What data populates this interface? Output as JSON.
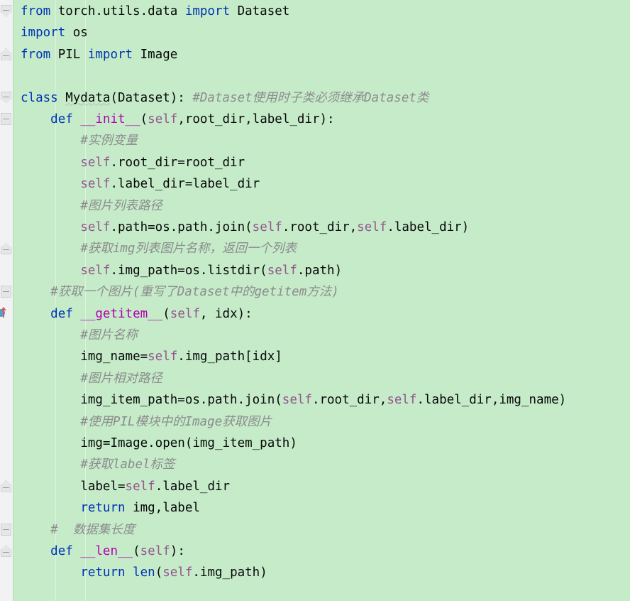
{
  "editor": {
    "app": "code-editor",
    "language": "Python",
    "background_color": "#c5ebc9",
    "gutter_color": "#f2f2f2",
    "colors": {
      "keyword": "#0033b3",
      "self": "#94558d",
      "dunder_method": "#b200b2",
      "comment": "#8c8c8c",
      "text": "#080808",
      "highlight_bg": "#c5ebc9"
    }
  },
  "gutter": {
    "override_marker_tooltip": "Overrides method in Dataset",
    "fold_markers": [
      {
        "type": "start",
        "line": 1
      },
      {
        "type": "end",
        "line": 3
      },
      {
        "type": "start",
        "line": 5
      },
      {
        "type": "stub",
        "line": 6
      },
      {
        "type": "end",
        "line": 12
      },
      {
        "type": "stub",
        "line": 14
      },
      {
        "type": "end",
        "line": 23
      },
      {
        "type": "stub",
        "line": 25
      },
      {
        "type": "end",
        "line": 26
      }
    ]
  },
  "code": {
    "lines": [
      {
        "n": 1,
        "indent": 0,
        "tokens": [
          {
            "t": "kw",
            "v": "from"
          },
          {
            "t": "id",
            "v": " torch.utils.data "
          },
          {
            "t": "kw",
            "v": "import"
          },
          {
            "t": "id",
            "v": " Dataset"
          }
        ]
      },
      {
        "n": 2,
        "indent": 0,
        "tokens": [
          {
            "t": "kw",
            "v": "import"
          },
          {
            "t": "id",
            "v": " os"
          }
        ]
      },
      {
        "n": 3,
        "indent": 0,
        "tokens": [
          {
            "t": "kw",
            "v": "from"
          },
          {
            "t": "id",
            "v": " PIL "
          },
          {
            "t": "kw",
            "v": "import"
          },
          {
            "t": "id",
            "v": " Image"
          }
        ]
      },
      {
        "n": 4,
        "indent": 0,
        "tokens": []
      },
      {
        "n": 5,
        "indent": 0,
        "tokens": [
          {
            "t": "kw",
            "v": "class"
          },
          {
            "t": "id",
            "v": " "
          },
          {
            "t": "wavy",
            "v": "Mydata"
          },
          {
            "t": "id",
            "v": "(Dataset): "
          },
          {
            "t": "cm",
            "v": "#Dataset使用时子类必须继承Dataset类"
          }
        ]
      },
      {
        "n": 6,
        "indent": 1,
        "tokens": [
          {
            "t": "kw",
            "v": "def"
          },
          {
            "t": "id",
            "v": " "
          },
          {
            "t": "fn",
            "v": "__init__"
          },
          {
            "t": "id",
            "v": "("
          },
          {
            "t": "self",
            "v": "self"
          },
          {
            "t": "id",
            "v": ",root_dir,label_dir):"
          }
        ]
      },
      {
        "n": 7,
        "indent": 2,
        "tokens": [
          {
            "t": "cm",
            "v": "#实例变量"
          }
        ]
      },
      {
        "n": 8,
        "indent": 2,
        "tokens": [
          {
            "t": "self",
            "v": "self"
          },
          {
            "t": "id",
            "v": ".root_dir=root_dir"
          }
        ]
      },
      {
        "n": 9,
        "indent": 2,
        "tokens": [
          {
            "t": "self",
            "v": "self"
          },
          {
            "t": "id",
            "v": ".label_dir=label_dir"
          }
        ]
      },
      {
        "n": 10,
        "indent": 2,
        "tokens": [
          {
            "t": "cm",
            "v": "#图片列表路径"
          }
        ]
      },
      {
        "n": 11,
        "indent": 2,
        "tokens": [
          {
            "t": "self",
            "v": "self"
          },
          {
            "t": "id",
            "v": ".path=os.path.join("
          },
          {
            "t": "self",
            "v": "self"
          },
          {
            "t": "id",
            "v": ".root_dir,"
          },
          {
            "t": "self",
            "v": "self"
          },
          {
            "t": "id",
            "v": ".label_dir)"
          }
        ]
      },
      {
        "n": 12,
        "indent": 2,
        "tokens": [
          {
            "t": "cm",
            "v": "#获取img列表图片名称，返回一个列表"
          }
        ]
      },
      {
        "n": 13,
        "indent": 2,
        "tokens": [
          {
            "t": "self",
            "v": "self"
          },
          {
            "t": "id",
            "v": ".img_path=os.listdir("
          },
          {
            "t": "self",
            "v": "self"
          },
          {
            "t": "id",
            "v": ".path)"
          }
        ]
      },
      {
        "n": 14,
        "indent": 1,
        "tokens": [
          {
            "t": "cm",
            "v": "#获取一个图片(重写了Dataset中的getitem方法)"
          }
        ]
      },
      {
        "n": 15,
        "indent": 1,
        "tokens": [
          {
            "t": "kw",
            "v": "def"
          },
          {
            "t": "id",
            "v": " "
          },
          {
            "t": "fn",
            "v": "__getitem__"
          },
          {
            "t": "id",
            "v": "("
          },
          {
            "t": "self",
            "v": "self"
          },
          {
            "t": "id",
            "v": ", idx):"
          }
        ]
      },
      {
        "n": 16,
        "indent": 2,
        "tokens": [
          {
            "t": "cm",
            "v": "#图片名称"
          }
        ]
      },
      {
        "n": 17,
        "indent": 2,
        "tokens": [
          {
            "t": "id",
            "v": "img_name="
          },
          {
            "t": "self",
            "v": "self"
          },
          {
            "t": "id",
            "v": ".img_path[idx]"
          }
        ]
      },
      {
        "n": 18,
        "indent": 2,
        "tokens": [
          {
            "t": "cm",
            "v": "#图片相对路径"
          }
        ]
      },
      {
        "n": 19,
        "indent": 2,
        "tokens": [
          {
            "t": "id",
            "v": "img_item_path=os.path.join("
          },
          {
            "t": "self",
            "v": "self"
          },
          {
            "t": "id",
            "v": ".root_dir,"
          },
          {
            "t": "self",
            "v": "self"
          },
          {
            "t": "id",
            "v": ".label_dir,img_name)"
          }
        ]
      },
      {
        "n": 20,
        "indent": 2,
        "tokens": [
          {
            "t": "cm",
            "v": "#使用PIL模块中的Image获取图片"
          }
        ]
      },
      {
        "n": 21,
        "indent": 2,
        "tokens": [
          {
            "t": "id",
            "v": "img=Image.open(img_item_path)"
          }
        ]
      },
      {
        "n": 22,
        "indent": 2,
        "tokens": [
          {
            "t": "cm",
            "v": "#获取label标签"
          }
        ]
      },
      {
        "n": 23,
        "indent": 2,
        "tokens": [
          {
            "t": "id",
            "v": "label="
          },
          {
            "t": "self",
            "v": "self"
          },
          {
            "t": "id",
            "v": ".label_dir"
          }
        ]
      },
      {
        "n": 24,
        "indent": 2,
        "tokens": [
          {
            "t": "kw",
            "v": "return"
          },
          {
            "t": "id",
            "v": " img,label"
          }
        ]
      },
      {
        "n": 25,
        "indent": 1,
        "tokens": [
          {
            "t": "cm",
            "v": "#  数据集长度"
          }
        ]
      },
      {
        "n": 26,
        "indent": 1,
        "tokens": [
          {
            "t": "kw",
            "v": "def"
          },
          {
            "t": "id",
            "v": " "
          },
          {
            "t": "fn",
            "v": "__len__"
          },
          {
            "t": "id",
            "v": "("
          },
          {
            "t": "self",
            "v": "self"
          },
          {
            "t": "id",
            "v": "):"
          }
        ]
      },
      {
        "n": 27,
        "indent": 2,
        "tokens": [
          {
            "t": "kw",
            "v": "return"
          },
          {
            "t": "id",
            "v": " "
          },
          {
            "t": "builtin",
            "v": "len"
          },
          {
            "t": "id",
            "v": "("
          },
          {
            "t": "self",
            "v": "self"
          },
          {
            "t": "id",
            "v": ".img_path)"
          }
        ]
      }
    ]
  }
}
